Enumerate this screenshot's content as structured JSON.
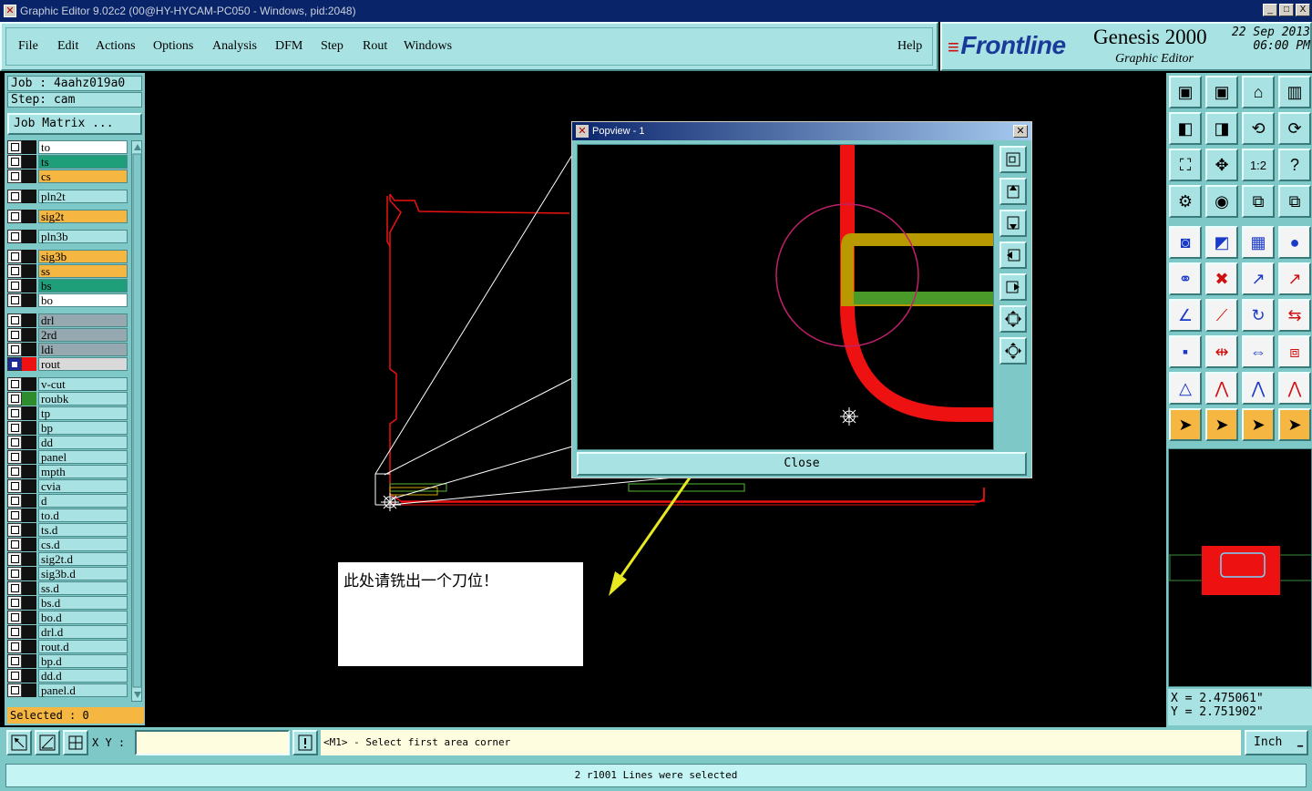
{
  "window": {
    "title": "Graphic Editor 9.02c2 (00@HY-HYCAM-PC050 - Windows, pid:2048)",
    "controls": [
      "_",
      "□",
      "X"
    ]
  },
  "menu": {
    "items": [
      "File",
      "Edit",
      "Actions",
      "Options",
      "Analysis",
      "DFM",
      "Step",
      "Rout",
      "Windows"
    ],
    "help": "Help"
  },
  "brand": {
    "logo": "Frontline",
    "product": "Genesis 2000",
    "subtitle": "Graphic Editor",
    "date": "22 Sep 2013",
    "time": "06:00 PM"
  },
  "job": {
    "job_line": "Job : 4aahz019a0",
    "step_line": "Step: cam",
    "matrix_button": "Job Matrix ..."
  },
  "layers": [
    {
      "name": "to",
      "color": "#ffffff",
      "swatch": "#111111",
      "group": 0
    },
    {
      "name": "ts",
      "color": "#1f9e7a",
      "swatch": "#111111",
      "group": 0
    },
    {
      "name": "cs",
      "color": "#f5b642",
      "swatch": "#111111",
      "group": 0
    },
    {
      "name": "pln2t",
      "color": "#a8e2e2",
      "swatch": "#111111",
      "group": 1
    },
    {
      "name": "sig2t",
      "color": "#f5b642",
      "swatch": "#111111",
      "group": 2
    },
    {
      "name": "pln3b",
      "color": "#a8e2e2",
      "swatch": "#111111",
      "group": 3
    },
    {
      "name": "sig3b",
      "color": "#f5b642",
      "swatch": "#111111",
      "group": 4
    },
    {
      "name": "ss",
      "color": "#f5b642",
      "swatch": "#111111",
      "group": 4
    },
    {
      "name": "bs",
      "color": "#1f9e7a",
      "swatch": "#111111",
      "group": 4
    },
    {
      "name": "bo",
      "color": "#ffffff",
      "swatch": "#111111",
      "group": 4
    },
    {
      "name": "drl",
      "color": "#96a8b0",
      "swatch": "#111111",
      "group": 5
    },
    {
      "name": "2rd",
      "color": "#96a8b0",
      "swatch": "#111111",
      "group": 5
    },
    {
      "name": "ldi",
      "color": "#96a8b0",
      "swatch": "#111111",
      "group": 5
    },
    {
      "name": "rout",
      "color": "#d9d9d9",
      "swatch": "#ee1111",
      "group": 5,
      "active": true
    },
    {
      "name": "v-cut",
      "color": "#a8e2e2",
      "swatch": "#111111",
      "group": 6
    },
    {
      "name": "roubk",
      "color": "#a8e2e2",
      "swatch": "#2e8b2e",
      "group": 6
    },
    {
      "name": "tp",
      "color": "#a8e2e2",
      "swatch": "#111111",
      "group": 6
    },
    {
      "name": "bp",
      "color": "#a8e2e2",
      "swatch": "#111111",
      "group": 6
    },
    {
      "name": "dd",
      "color": "#a8e2e2",
      "swatch": "#111111",
      "group": 6
    },
    {
      "name": "panel",
      "color": "#a8e2e2",
      "swatch": "#111111",
      "group": 6
    },
    {
      "name": "mpth",
      "color": "#a8e2e2",
      "swatch": "#111111",
      "group": 6
    },
    {
      "name": "cvia",
      "color": "#a8e2e2",
      "swatch": "#111111",
      "group": 6
    },
    {
      "name": "d",
      "color": "#a8e2e2",
      "swatch": "#111111",
      "group": 6
    },
    {
      "name": "to.d",
      "color": "#a8e2e2",
      "swatch": "#111111",
      "group": 6
    },
    {
      "name": "ts.d",
      "color": "#a8e2e2",
      "swatch": "#111111",
      "group": 6
    },
    {
      "name": "cs.d",
      "color": "#a8e2e2",
      "swatch": "#111111",
      "group": 6
    },
    {
      "name": "sig2t.d",
      "color": "#a8e2e2",
      "swatch": "#111111",
      "group": 6
    },
    {
      "name": "sig3b.d",
      "color": "#a8e2e2",
      "swatch": "#111111",
      "group": 6
    },
    {
      "name": "ss.d",
      "color": "#a8e2e2",
      "swatch": "#111111",
      "group": 6
    },
    {
      "name": "bs.d",
      "color": "#a8e2e2",
      "swatch": "#111111",
      "group": 6
    },
    {
      "name": "bo.d",
      "color": "#a8e2e2",
      "swatch": "#111111",
      "group": 6
    },
    {
      "name": "drl.d",
      "color": "#a8e2e2",
      "swatch": "#111111",
      "group": 6
    },
    {
      "name": "rout.d",
      "color": "#a8e2e2",
      "swatch": "#111111",
      "group": 6
    },
    {
      "name": "bp.d",
      "color": "#a8e2e2",
      "swatch": "#111111",
      "group": 6
    },
    {
      "name": "dd.d",
      "color": "#a8e2e2",
      "swatch": "#111111",
      "group": 6
    },
    {
      "name": "panel.d",
      "color": "#a8e2e2",
      "swatch": "#111111",
      "group": 6
    }
  ],
  "selected": "Selected : 0",
  "popview": {
    "title": "Popview - 1",
    "close_label": "Close"
  },
  "annotation": {
    "text": "此处请铣出一个刀位！"
  },
  "toolbox": {
    "rows": [
      [
        "zoom-home-icon",
        "zoom-page-icon",
        "home-icon",
        "window-icon"
      ],
      [
        "pan-left-icon",
        "pan-right-icon",
        "undo-view-icon",
        "redraw-icon"
      ],
      [
        "fit-icon",
        "center-icon",
        "one-to-one-icon",
        "query-icon"
      ],
      [
        "measure-tools-icon",
        "snap-icon",
        "layer-compare-icon",
        "layer-compare-2-icon"
      ],
      [
        "add-pad-icon",
        "add-feature-icon",
        "ruler-icon",
        "add-round-icon"
      ],
      [
        "connect-icon",
        "delete-icon",
        "move-point-icon",
        "add-line-icon"
      ],
      [
        "angle-line-icon",
        "diagonal-line-icon",
        "arc-icon",
        "mirror-icon"
      ],
      [
        "select-pad-icon",
        "split-line-icon",
        "stretch-icon",
        "group-icon"
      ],
      [
        "fillet-icon",
        "offset-icon",
        "outline-icon",
        "chamfer-icon"
      ],
      [
        "select-pointer-icon",
        "select-box-icon",
        "select-poly-icon",
        "select-route-icon"
      ]
    ]
  },
  "coordinates": {
    "x": "X = 2.475061\"",
    "y": "Y = 2.751902\""
  },
  "bottom": {
    "xy_label": "X Y :",
    "xy_value": "",
    "prompt": "<M1> - Select first area corner",
    "units": "Inch",
    "status": "2 r1001 Lines were selected"
  },
  "colors": {
    "rout_outline": "#ee1111",
    "annotation_arrow": "#e8e820",
    "highlight_circle": "#c0206a",
    "panel_bg": "#7ec8c8",
    "panel_light": "#a8e2e2"
  }
}
